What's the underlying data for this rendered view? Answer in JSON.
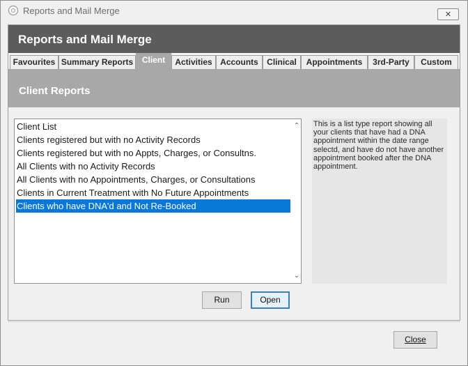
{
  "window": {
    "title": "Reports and Mail Merge",
    "close_glyph": "✕"
  },
  "header": {
    "title": "Reports and Mail Merge"
  },
  "tabs": [
    {
      "label": "Favourites",
      "active": false
    },
    {
      "label": "Summary Reports",
      "active": false
    },
    {
      "label": "Client",
      "active": true
    },
    {
      "label": "Activities",
      "active": false
    },
    {
      "label": "Accounts",
      "active": false
    },
    {
      "label": "Clinical",
      "active": false
    },
    {
      "label": "Appointments",
      "active": false
    },
    {
      "label": "3rd-Party",
      "active": false
    },
    {
      "label": "Custom",
      "active": false
    }
  ],
  "section": {
    "title": "Client Reports"
  },
  "reports": {
    "items": [
      "Client List",
      "Clients registered but with no Activity Records",
      "Clients registered but with no Appts, Charges, or Consultns.",
      "All Clients with no Activity Records",
      "All Clients with no Appointments, Charges, or Consultations",
      "Clients in Current Treatment with No Future Appointments",
      "Clients who have DNA'd and Not Re-Booked"
    ],
    "selected_index": 6,
    "scroll_up": "⌃",
    "scroll_down": "⌄"
  },
  "description": {
    "text": "This is a list type report showing all your clients that have had a DNA appointment within the date range selectd, and have do not have another appointment booked after the DNA appointment."
  },
  "buttons": {
    "run": "Run",
    "open": "Open",
    "close": "Close"
  },
  "colors": {
    "header_bg": "#5c5c5c",
    "section_bg": "#a8a8a8",
    "selection": "#0a78d7",
    "focus_border": "#3c7fb1"
  }
}
